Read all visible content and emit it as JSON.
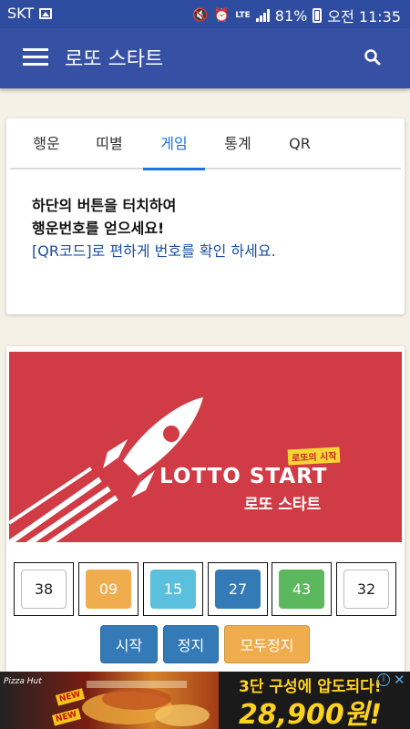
{
  "status_bar": {
    "carrier": "SKT",
    "network": "LTE",
    "battery": "81%",
    "time": "오전 11:35"
  },
  "app_bar": {
    "title": "로또 스타트"
  },
  "tabs": [
    {
      "label": "행운",
      "active": false
    },
    {
      "label": "띠별",
      "active": false
    },
    {
      "label": "게임",
      "active": true
    },
    {
      "label": "통계",
      "active": false
    },
    {
      "label": "QR",
      "active": false
    }
  ],
  "info": {
    "line1": "하단의 버튼을 터치하여",
    "line2": "행운번호를 얻으세요!",
    "line3": "[QR코드]로 편하게 번호를 확인 하세요."
  },
  "banner": {
    "title": "LOTTO START",
    "subtitle": "로또 스타트",
    "tag": "로또의 시작"
  },
  "balls": [
    {
      "number": "38",
      "color": "#ffffff"
    },
    {
      "number": "09",
      "color": "#f0ad4e"
    },
    {
      "number": "15",
      "color": "#5bc0de"
    },
    {
      "number": "27",
      "color": "#337ab7"
    },
    {
      "number": "43",
      "color": "#5cb85c"
    },
    {
      "number": "32",
      "color": "#ffffff"
    }
  ],
  "buttons": {
    "start": "시작",
    "stop": "정지",
    "stop_all": "모두정지"
  },
  "colors": {
    "app_bar": "#3651a4",
    "banner": "#d03b45",
    "tab_active": "#1a73e8",
    "button_blue": "#337ab7",
    "button_orange": "#f0ad4e"
  },
  "ad": {
    "brand": "Pizza Hut",
    "badge": "NEW",
    "line1": "3단 구성에 압도되다!",
    "line2": "28,900원!"
  }
}
